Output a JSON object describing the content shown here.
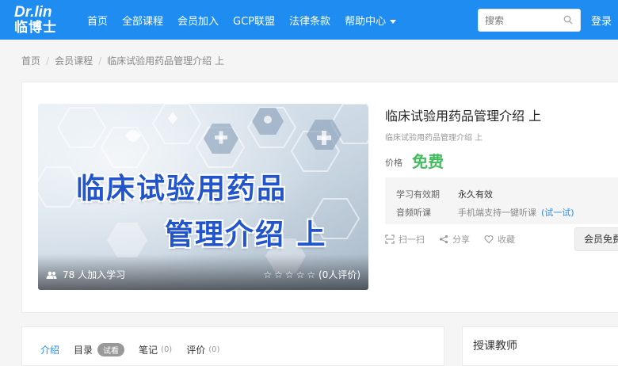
{
  "header": {
    "logo_top": "Dr.lin",
    "logo_bottom": "临博士",
    "nav": [
      "首页",
      "全部课程",
      "会员加入",
      "GCP联盟",
      "法律条款",
      "帮助中心"
    ],
    "search_placeholder": "搜索",
    "login_label": "登录",
    "brand_color": "#1e8cf0"
  },
  "breadcrumb": {
    "items": [
      "首页",
      "会员课程",
      "临床试验用药品管理介绍 上"
    ],
    "separator": "/"
  },
  "course": {
    "cover_title_line1": "临床试验用药品",
    "cover_title_line2": "管理介绍 上",
    "learners_count": "78",
    "learners_suffix": "人加入学习",
    "rating_stars": 0,
    "rating_text": "(0人评价)",
    "title": "临床试验用药品管理介绍 上",
    "subtitle": "临床试验用药品管理介绍 上",
    "price_label": "价格",
    "price_value": "免费",
    "price_color": "#43bc60",
    "validity_label": "学习有效期",
    "validity_value": "永久有效",
    "audio_label": "音频听课",
    "audio_value": "手机端支持一键听课",
    "audio_link": "(试一试)",
    "actions": [
      "扫一扫",
      "分享",
      "收藏"
    ],
    "vip_button": "会员免费学"
  },
  "tabs": {
    "items": [
      {
        "label": "介绍",
        "count": ""
      },
      {
        "label": "目录",
        "badge": "试看"
      },
      {
        "label": "笔记",
        "count": "(0)"
      },
      {
        "label": "评价",
        "count": "(0)"
      }
    ]
  },
  "sidebar": {
    "teacher_heading": "授课教师"
  }
}
